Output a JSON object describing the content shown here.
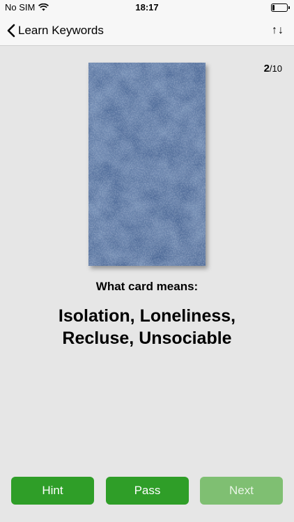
{
  "status_bar": {
    "carrier": "No SIM",
    "time": "18:17",
    "battery_level": 0.15
  },
  "nav": {
    "back_label": "Learn Keywords",
    "sort_icon": "↑↓",
    "back_icon": "chevron-left"
  },
  "counter": {
    "current": "2",
    "total": "/10"
  },
  "card": {
    "color": "#4a6796"
  },
  "prompt": "What card means:",
  "meaning": {
    "line1": "Isolation, Loneliness,",
    "line2": "Recluse, Unsociable"
  },
  "buttons": {
    "hint": "Hint",
    "pass": "Pass",
    "next": "Next"
  },
  "colors": {
    "primary_green": "#2f9e28",
    "disabled_green": "#7fbf72",
    "background": "#e6e6e6"
  }
}
